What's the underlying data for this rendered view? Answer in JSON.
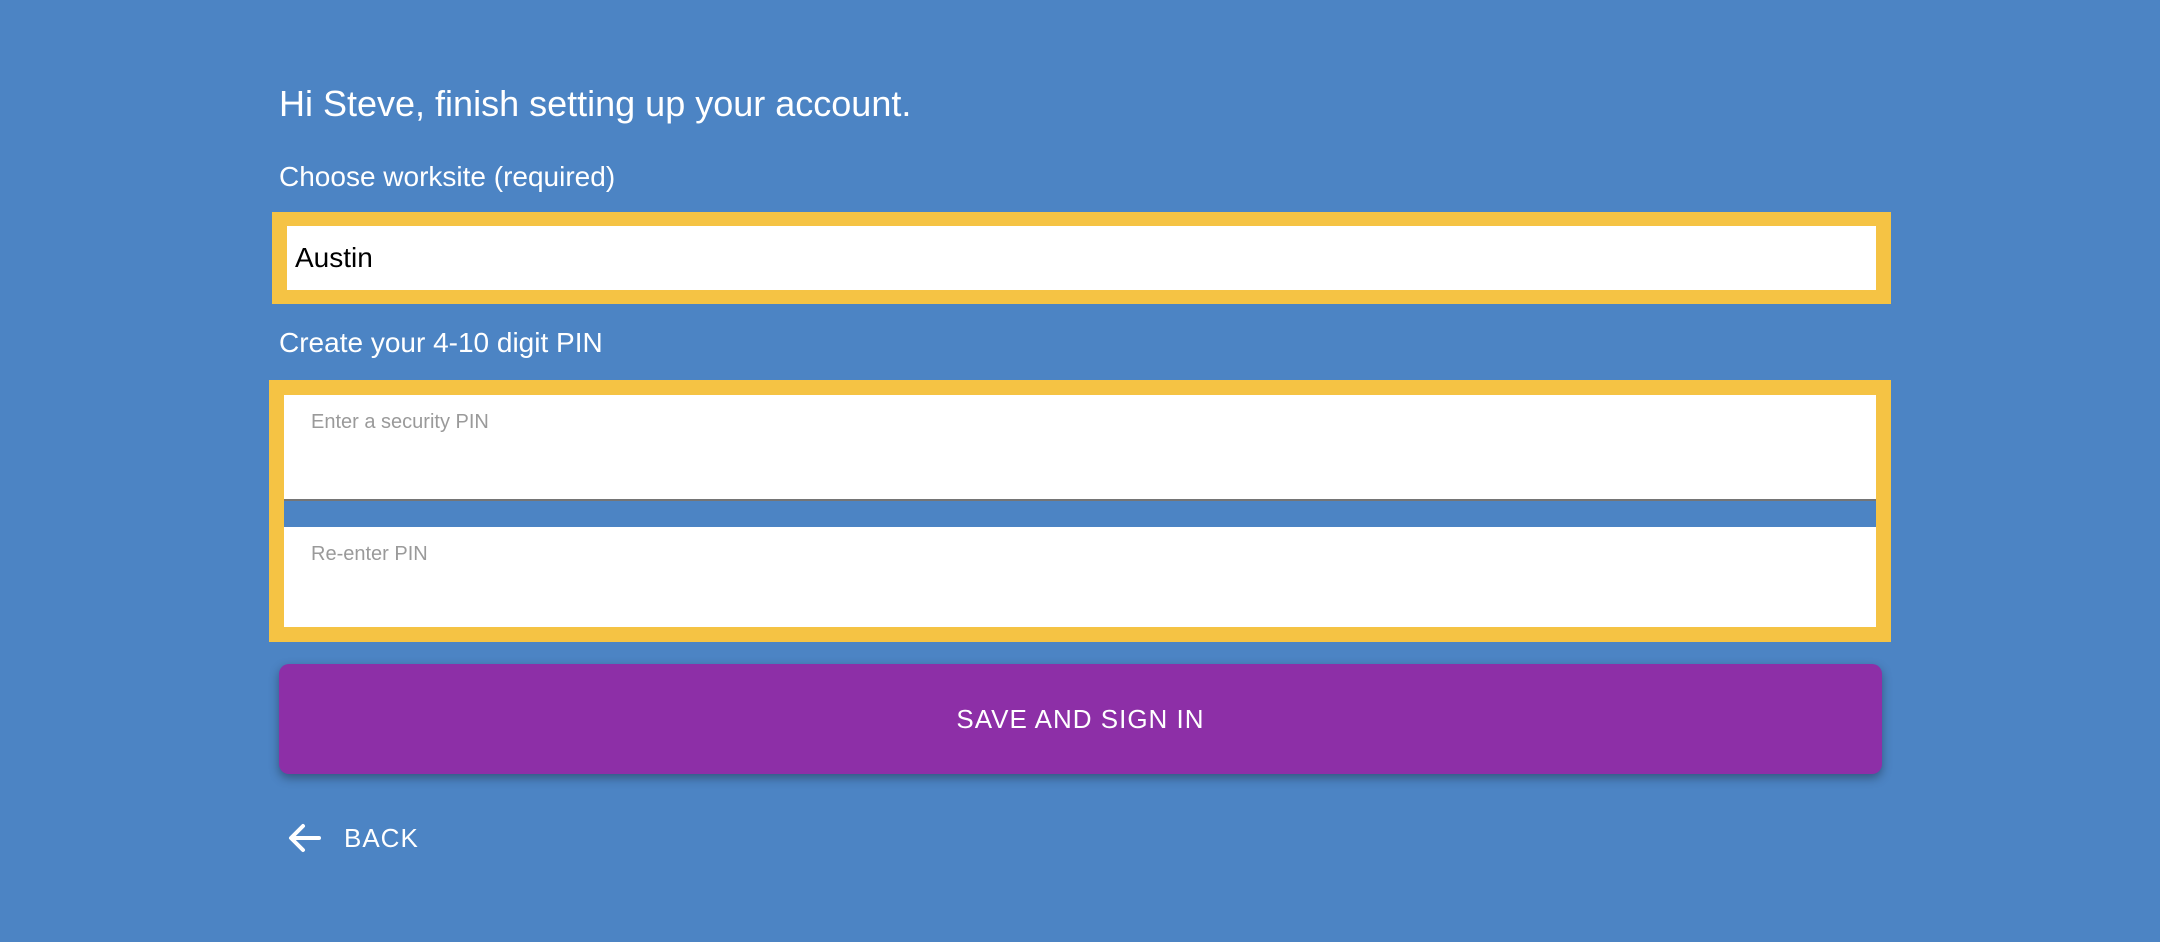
{
  "header": {
    "greeting": "Hi Steve, finish setting up your account."
  },
  "worksite": {
    "label": "Choose worksite (required)",
    "value": "Austin"
  },
  "pin": {
    "label": "Create your 4-10 digit PIN",
    "pin_placeholder": "Enter a security PIN",
    "confirm_placeholder": "Re-enter PIN"
  },
  "actions": {
    "save_label": "SAVE AND SIGN IN",
    "back_label": "BACK"
  },
  "icons": {
    "back": "arrow-left-icon"
  },
  "colors": {
    "background": "#4c84c4",
    "highlight": "#f5c344",
    "primary_button": "#8d2fa7",
    "text": "#ffffff"
  }
}
